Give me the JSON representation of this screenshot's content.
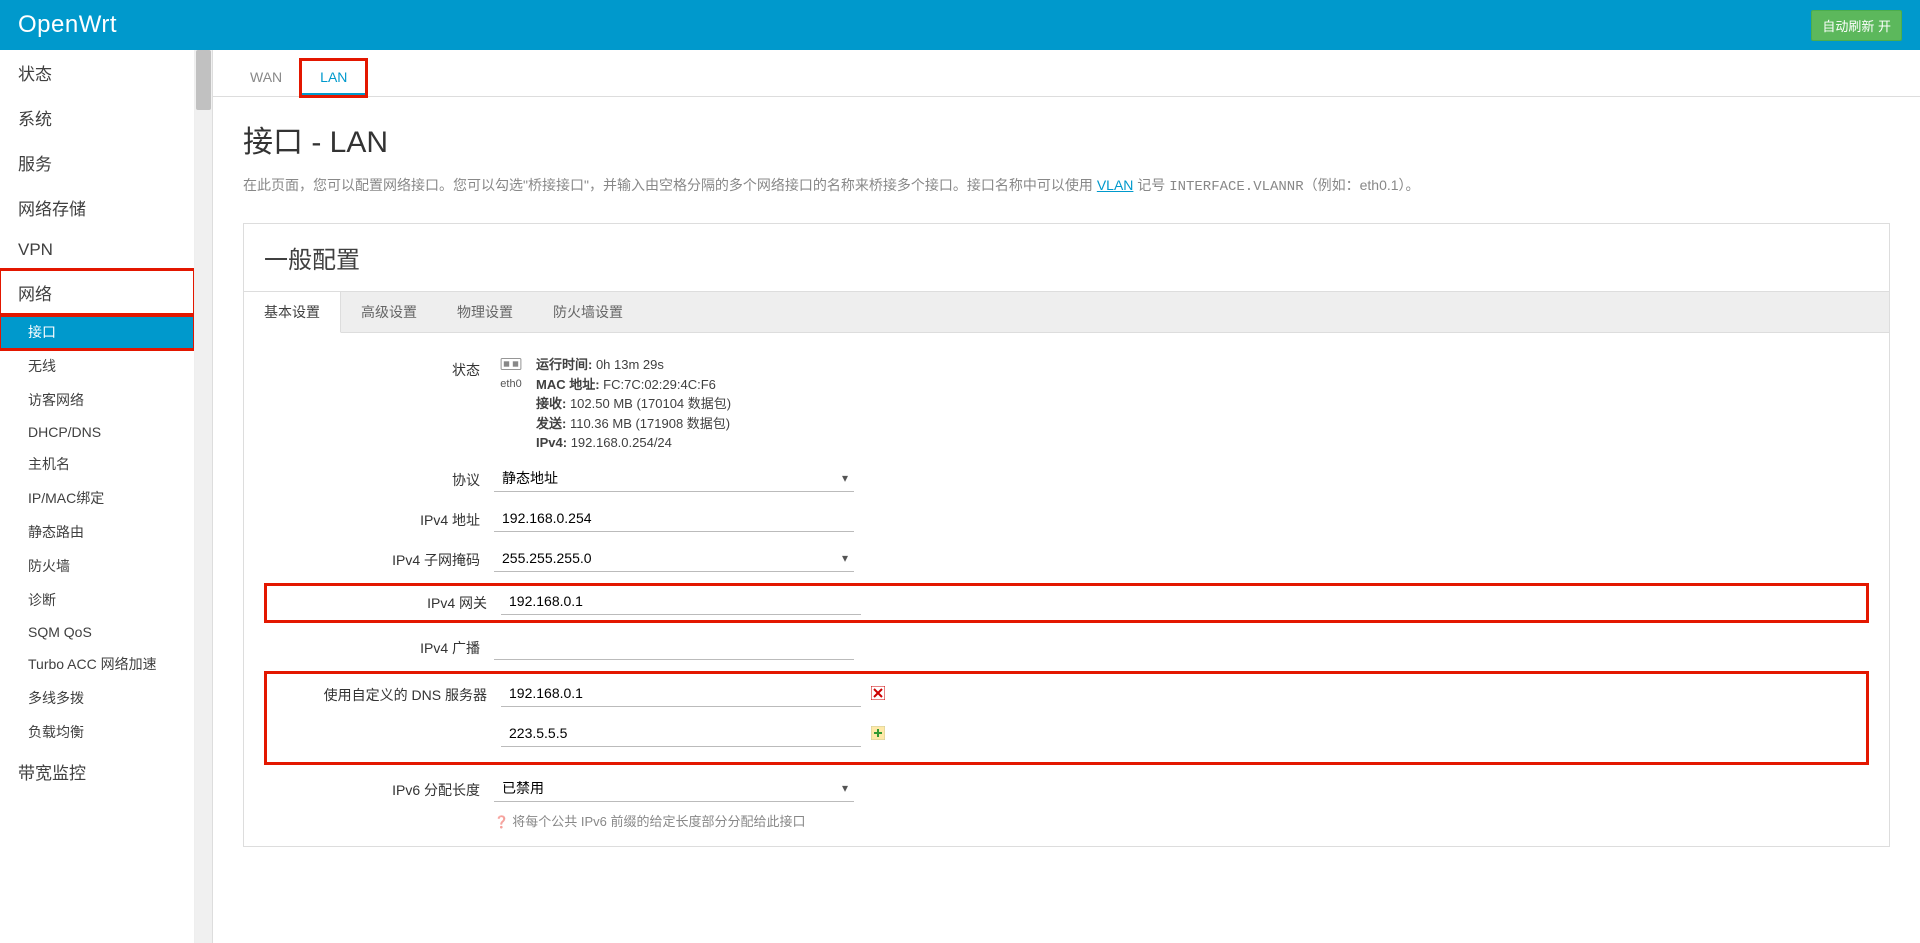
{
  "header": {
    "brand": "OpenWrt",
    "auto_refresh": "自动刷新 开"
  },
  "sidebar": {
    "cats": [
      {
        "label": "状态",
        "items": []
      },
      {
        "label": "系统",
        "items": []
      },
      {
        "label": "服务",
        "items": []
      },
      {
        "label": "网络存储",
        "items": []
      },
      {
        "label": "VPN",
        "items": []
      },
      {
        "label": "网络",
        "highlight": true,
        "items": [
          {
            "label": "接口",
            "active": true,
            "highlight": true
          },
          {
            "label": "无线"
          },
          {
            "label": "访客网络"
          },
          {
            "label": "DHCP/DNS"
          },
          {
            "label": "主机名"
          },
          {
            "label": "IP/MAC绑定"
          },
          {
            "label": "静态路由"
          },
          {
            "label": "防火墙"
          },
          {
            "label": "诊断"
          },
          {
            "label": "SQM QoS"
          },
          {
            "label": "Turbo ACC 网络加速"
          },
          {
            "label": "多线多拨"
          },
          {
            "label": "负载均衡"
          }
        ]
      },
      {
        "label": "带宽监控",
        "items": []
      }
    ]
  },
  "iface_tabs": [
    {
      "label": "WAN"
    },
    {
      "label": "LAN",
      "active": true,
      "highlight": true
    }
  ],
  "page": {
    "title": "接口 - LAN",
    "desc_pre": "在此页面，您可以配置网络接口。您可以勾选\"桥接接口\"，并输入由空格分隔的多个网络接口的名称来桥接多个接口。接口名称中可以使用 ",
    "desc_link": "VLAN",
    "desc_post": " 记号 ",
    "desc_code": "INTERFACE.VLANNR",
    "desc_tail": "（例如：eth0.1）。"
  },
  "section": {
    "title": "一般配置",
    "tabs": [
      {
        "label": "基本设置",
        "active": true
      },
      {
        "label": "高级设置"
      },
      {
        "label": "物理设置"
      },
      {
        "label": "防火墙设置"
      }
    ]
  },
  "form": {
    "status_label": "状态",
    "iface_name": "eth0",
    "status": {
      "uptime_k": "运行时间:",
      "uptime_v": " 0h 13m 29s",
      "mac_k": "MAC 地址:",
      "mac_v": " FC:7C:02:29:4C:F6",
      "rx_k": "接收:",
      "rx_v": " 102.50 MB (170104 数据包)",
      "tx_k": "发送:",
      "tx_v": " 110.36 MB (171908 数据包)",
      "ipv4_k": "IPv4:",
      "ipv4_v": " 192.168.0.254/24"
    },
    "proto_label": "协议",
    "proto_value": "静态地址",
    "ipv4addr_label": "IPv4 地址",
    "ipv4addr_value": "192.168.0.254",
    "netmask_label": "IPv4 子网掩码",
    "netmask_value": "255.255.255.0",
    "gateway_label": "IPv4 网关",
    "gateway_value": "192.168.0.1",
    "bcast_label": "IPv4 广播",
    "bcast_value": "",
    "dns_label": "使用自定义的 DNS 服务器",
    "dns1": "192.168.0.1",
    "dns2": "223.5.5.5",
    "ip6len_label": "IPv6 分配长度",
    "ip6len_value": "已禁用",
    "ip6len_hint": "将每个公共 IPv6 前缀的给定长度部分分配给此接口"
  }
}
